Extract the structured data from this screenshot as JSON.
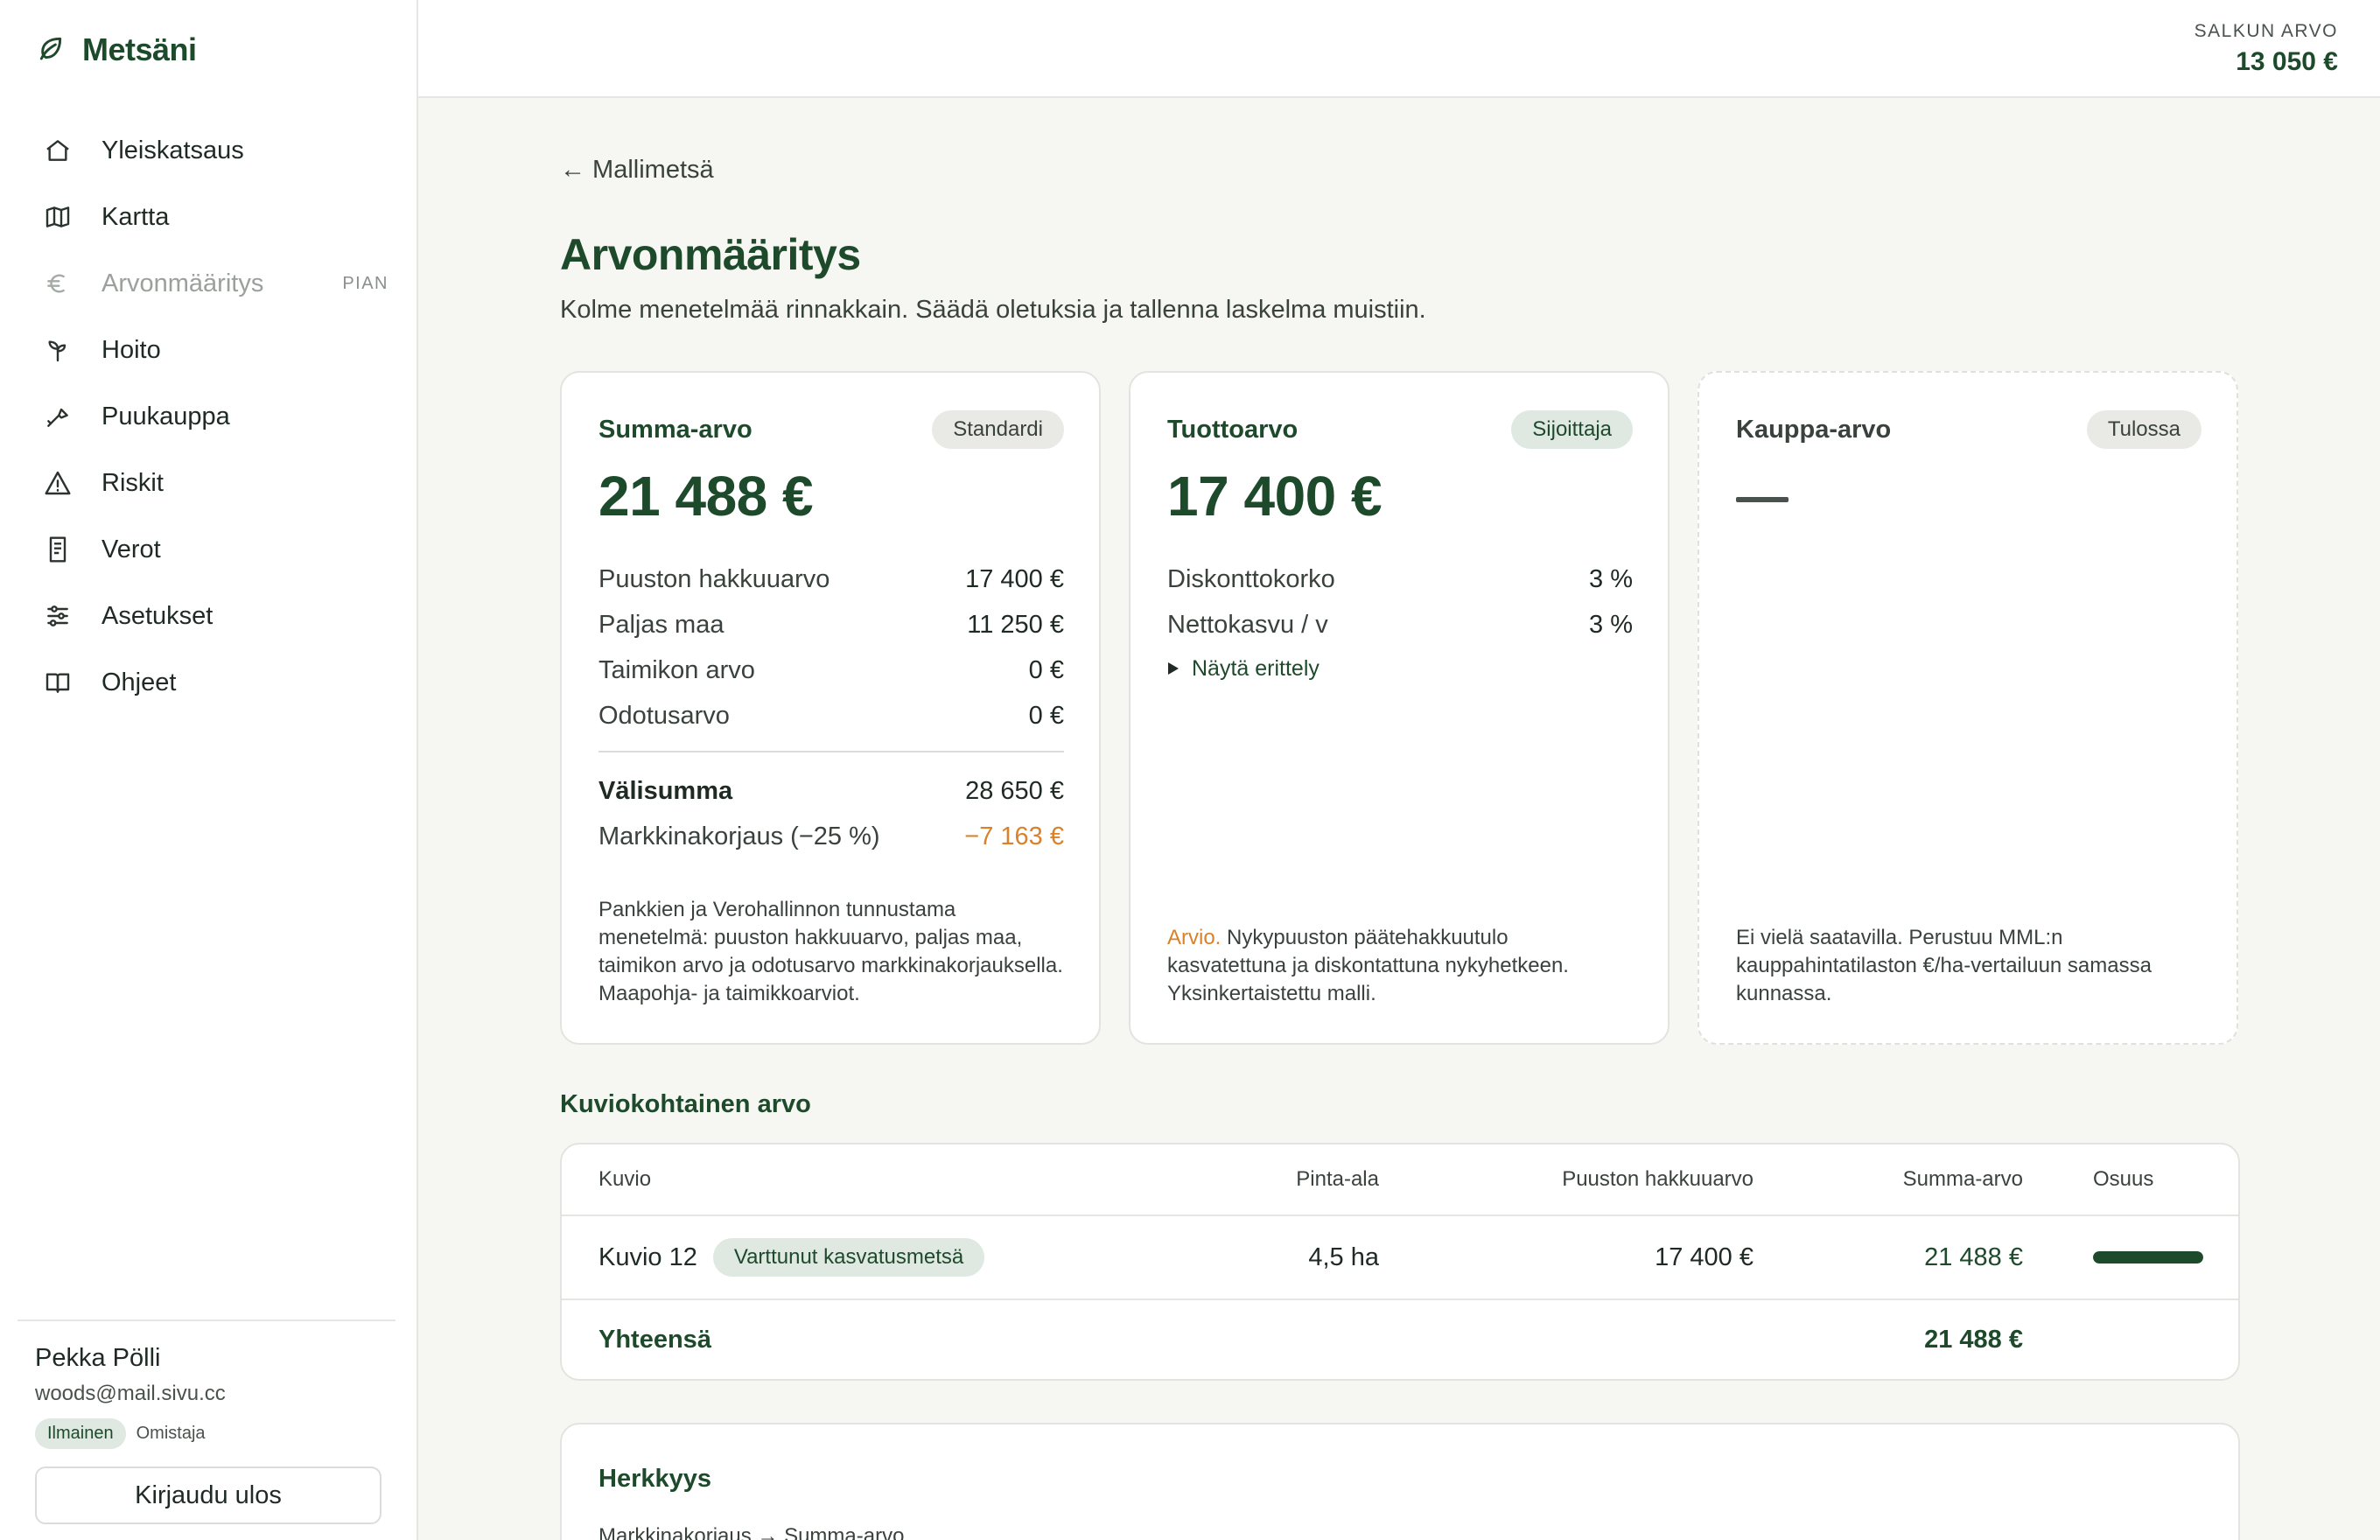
{
  "app": {
    "name": "Metsäni"
  },
  "nav": [
    {
      "label": "Yleiskatsaus",
      "icon": "home-icon"
    },
    {
      "label": "Kartta",
      "icon": "map-icon"
    },
    {
      "label": "Arvonmääritys",
      "icon": "euro-icon",
      "badge": "PIAN",
      "disabled": true
    },
    {
      "label": "Hoito",
      "icon": "sprout-icon"
    },
    {
      "label": "Puukauppa",
      "icon": "axe-icon"
    },
    {
      "label": "Riskit",
      "icon": "warning-icon"
    },
    {
      "label": "Verot",
      "icon": "receipt-icon"
    },
    {
      "label": "Asetukset",
      "icon": "sliders-icon"
    },
    {
      "label": "Ohjeet",
      "icon": "book-icon"
    }
  ],
  "user": {
    "name": "Pekka Pölli",
    "email": "woods@mail.sivu.cc",
    "plan": "Ilmainen",
    "role": "Omistaja",
    "logout_label": "Kirjaudu ulos"
  },
  "header": {
    "portfolio_caption": "SALKUN ARVO",
    "portfolio_value": "13 050 €"
  },
  "page": {
    "back_label": "← Mallimetsä",
    "title": "Arvonmääritys",
    "subtitle": "Kolme menetelmää rinnakkain. Säädä oletuksia ja tallenna laskelma muistiin."
  },
  "cards": {
    "summa": {
      "title": "Summa-arvo",
      "tag": "Standardi",
      "value": "21 488 €",
      "rows": [
        {
          "label": "Puuston hakkuuarvo",
          "value": "17 400 €"
        },
        {
          "label": "Paljas maa",
          "value": "11 250 €"
        },
        {
          "label": "Taimikon arvo",
          "value": "0 €"
        },
        {
          "label": "Odotusarvo",
          "value": "0 €"
        }
      ],
      "subtotal_label": "Välisumma",
      "subtotal_value": "28 650 €",
      "correction_label": "Markkinakorjaus (−25 %)",
      "correction_value": "−7 163 €",
      "note": "Pankkien ja Verohallinnon tunnustama menetelmä: puuston hakkuuarvo, paljas maa, taimikon arvo ja odotusarvo markkinakorjauksella. Maapohja- ja taimikkoarviot."
    },
    "tuotto": {
      "title": "Tuottoarvo",
      "tag": "Sijoittaja",
      "value": "17 400 €",
      "rows": [
        {
          "label": "Diskonttokorko",
          "value": "3 %"
        },
        {
          "label": "Nettokasvu / v",
          "value": "3 %"
        }
      ],
      "expander_label": "Näytä erittely",
      "note_highlight": "Arvio.",
      "note": " Nykypuuston päätehakkuutulo kasvatettuna ja diskontattuna nykyhetkeen. Yksinkertaistettu malli."
    },
    "kauppa": {
      "title": "Kauppa-arvo",
      "tag": "Tulossa",
      "note": "Ei vielä saatavilla. Perustuu MML:n kauppahintatilaston €/ha-vertailuun samassa kunnassa."
    }
  },
  "table": {
    "title": "Kuviokohtainen arvo",
    "headers": {
      "kuvio": "Kuvio",
      "ala": "Pinta-ala",
      "hakkuu": "Puuston hakkuuarvo",
      "summa": "Summa-arvo",
      "osuus": "Osuus"
    },
    "rows": [
      {
        "kuvio": "Kuvio 12",
        "tag": "Varttunut kasvatusmetsä",
        "ala": "4,5 ha",
        "hakkuu": "17 400 €",
        "summa": "21 488 €",
        "share_percent": 100
      }
    ],
    "total_label": "Yhteensä",
    "total_value": "21 488 €"
  },
  "sensitivity": {
    "title": "Herkkyys",
    "subtitle": "Markkinakorjaus → Summa-arvo"
  },
  "colors": {
    "brand": "#1e4a2c",
    "accent_orange": "#d9822b",
    "tag_green_bg": "#dfe8e1"
  }
}
